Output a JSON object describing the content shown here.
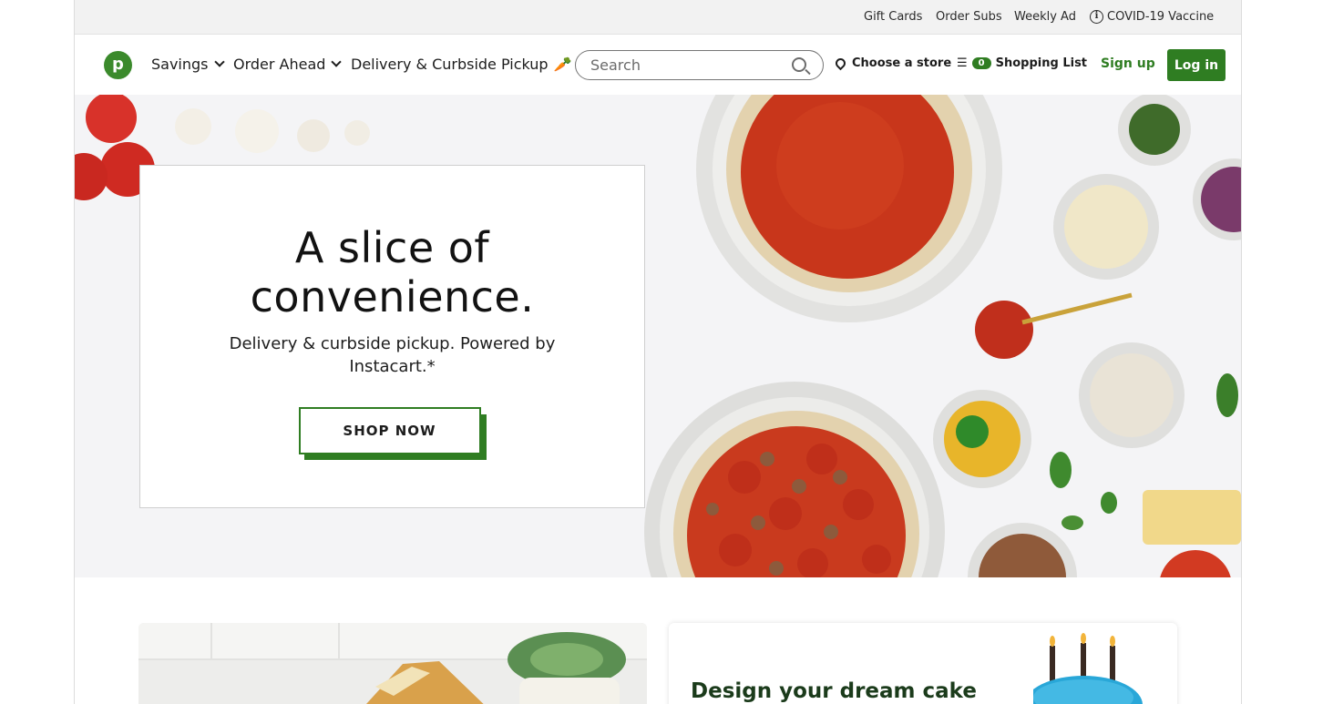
{
  "utility": {
    "gift_cards": "Gift Cards",
    "order_subs": "Order Subs",
    "weekly_ad": "Weekly Ad",
    "covid": "COVID-19 Vaccine",
    "info_icon": "info-icon"
  },
  "nav": {
    "logo_letter": "p",
    "savings": "Savings",
    "order_ahead": "Order Ahead",
    "delivery": "Delivery & Curbside Pickup",
    "carrot_icon": "carrot-icon",
    "search_placeholder": "Search",
    "choose_store": "Choose a store",
    "list_count": "0",
    "shopping_list": "Shopping List",
    "sign_up": "Sign up",
    "log_in": "Log in"
  },
  "hero": {
    "title_line1": "A slice of",
    "title_line2": "convenience.",
    "subtitle": "Delivery & curbside pickup. Powered by Instacart.*",
    "cta": "SHOP NOW"
  },
  "promos": {
    "cake_title": "Design your dream cake"
  },
  "colors": {
    "brand_green": "#2f7d22",
    "logo_green": "#3b8a2c",
    "utility_bg": "#f2f2f2"
  }
}
